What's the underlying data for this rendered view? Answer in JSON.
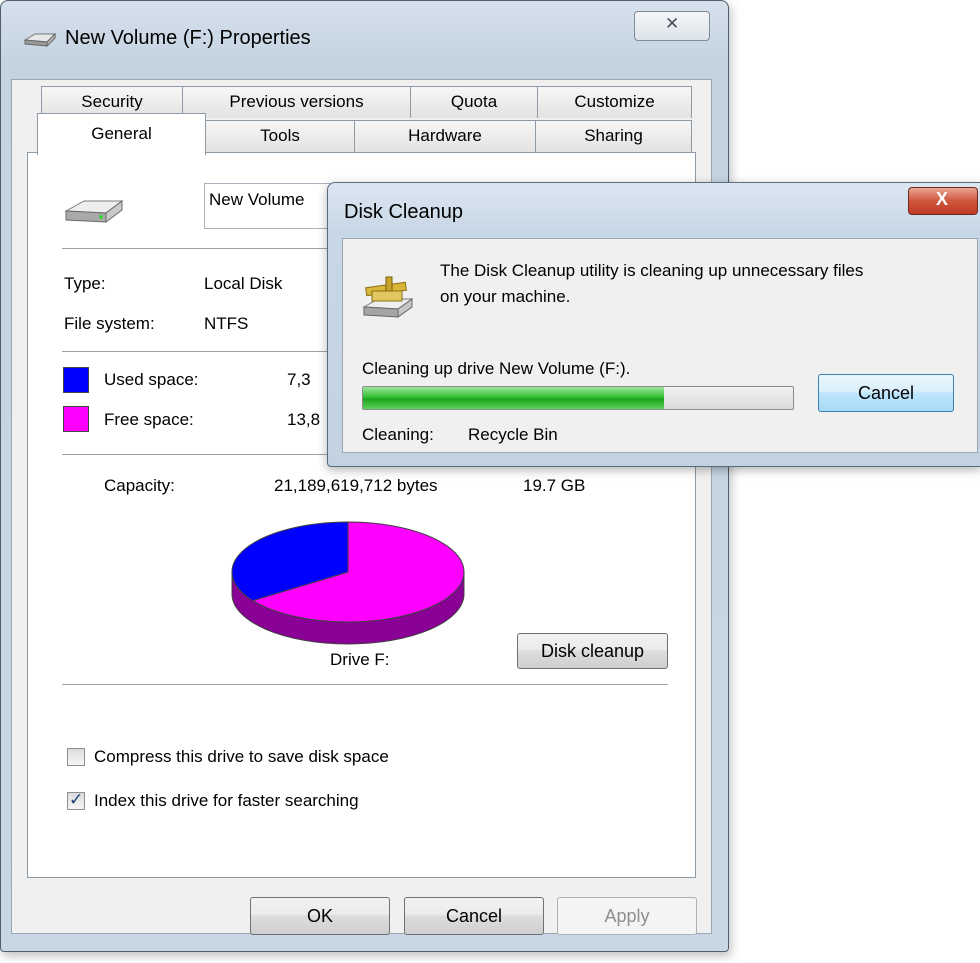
{
  "properties": {
    "title": "New Volume (F:) Properties",
    "close_glyph": "✕",
    "tabs_row1": [
      "Security",
      "Previous versions",
      "Quota",
      "Customize"
    ],
    "tabs_row2": [
      "General",
      "Tools",
      "Hardware",
      "Sharing"
    ],
    "active_tab": "General",
    "drive_name_value": "New Volume",
    "type_label": "Type:",
    "type_value": "Local Disk",
    "fs_label": "File system:",
    "fs_value": "NTFS",
    "used_label": "Used space:",
    "used_value": "7,3",
    "free_label": "Free space:",
    "free_value": "13,8",
    "capacity_label": "Capacity:",
    "capacity_bytes": "21,189,619,712 bytes",
    "capacity_gb": "19.7 GB",
    "drive_caption": "Drive F:",
    "disk_cleanup_button": "Disk cleanup",
    "compress_label": "Compress this drive to save disk space",
    "compress_checked": false,
    "index_label": "Index this drive for faster searching",
    "index_checked": true,
    "ok_button": "OK",
    "cancel_button": "Cancel",
    "apply_button": "Apply",
    "used_color": "#0000ff",
    "free_color": "#ff00ff",
    "used_fraction": 0.347
  },
  "cleanup": {
    "title": "Disk Cleanup",
    "close_glyph": "X",
    "message": "The Disk Cleanup utility is cleaning up unnecessary files",
    "message_line2": "on your machine.",
    "status": "Cleaning up drive New Volume (F:).",
    "progress": 0.7,
    "cleaning_label": "Cleaning:",
    "cleaning_item": "Recycle Bin",
    "cancel_button": "Cancel"
  }
}
